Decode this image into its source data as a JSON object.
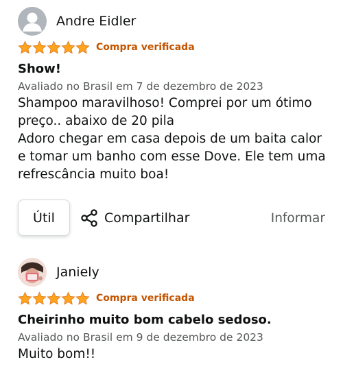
{
  "reviews": [
    {
      "author": "Andre Eidler",
      "avatar": "default-person-icon",
      "rating": 5,
      "verified_label": "Compra verificada",
      "title": "Show!",
      "date": "Avaliado no Brasil em 7 de dezembro de 2023",
      "body": [
        "Shampoo maravilhoso! Comprei por um ótimo preço.. abaixo de 20 pila",
        "Adoro chegar em casa depois de um baita calor e tomar um banho com esse Dove. Ele tem uma refrescância muito boa!"
      ]
    },
    {
      "author": "Janiely",
      "avatar": "user-photo",
      "rating": 5,
      "verified_label": "Compra verificada",
      "title": "Cheirinho muito bom cabelo sedoso.",
      "date": "Avaliado no Brasil em 9 de dezembro de 2023",
      "body": [
        "Muito bom!!"
      ]
    }
  ],
  "actions": {
    "helpful_label": "Útil",
    "share_label": "Compartilhar",
    "report_label": "Informar"
  },
  "colors": {
    "star": "#ffa41c",
    "verified": "#c45500",
    "secondary_text": "#565959",
    "primary_text": "#0f1111"
  }
}
